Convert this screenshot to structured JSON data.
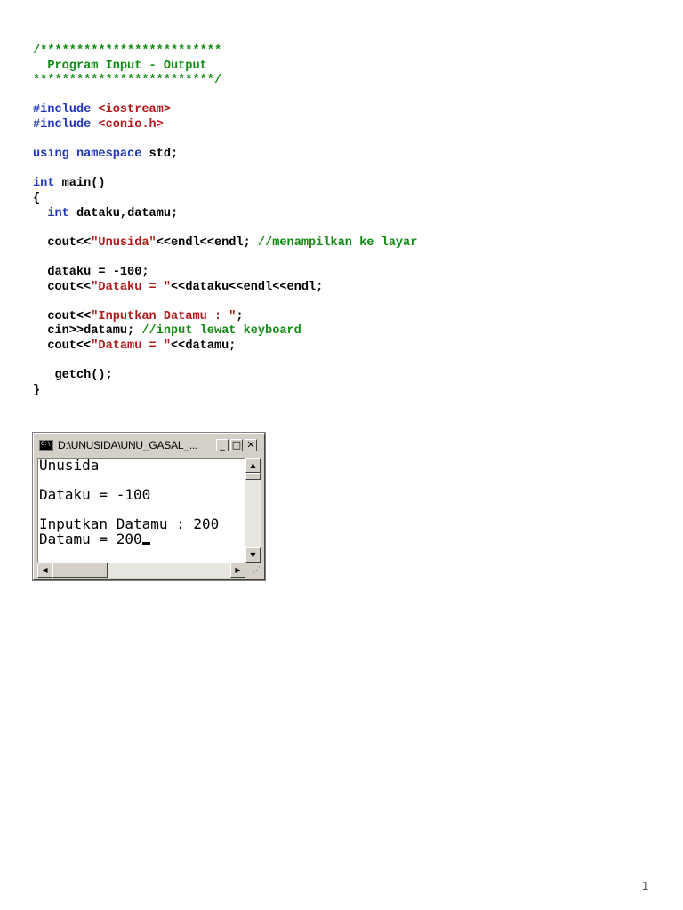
{
  "code_lines": [
    [
      {
        "t": "/*************************",
        "c": "c"
      }
    ],
    [
      {
        "t": "  Program Input - Output",
        "c": "c"
      }
    ],
    [
      {
        "t": "*************************/",
        "c": "c"
      }
    ],
    [],
    [
      {
        "t": "#include ",
        "c": "k"
      },
      {
        "t": "<iostream>",
        "c": "s"
      }
    ],
    [
      {
        "t": "#include ",
        "c": "k"
      },
      {
        "t": "<conio.h>",
        "c": "s"
      }
    ],
    [],
    [
      {
        "t": "using namespace",
        "c": "k"
      },
      {
        "t": " std;",
        "c": "n"
      }
    ],
    [],
    [
      {
        "t": "int",
        "c": "k"
      },
      {
        "t": " main()",
        "c": "n"
      }
    ],
    [
      {
        "t": "{",
        "c": "n"
      }
    ],
    [
      {
        "t": "  ",
        "c": "n"
      },
      {
        "t": "int",
        "c": "k"
      },
      {
        "t": " dataku,datamu;",
        "c": "n"
      }
    ],
    [],
    [
      {
        "t": "  cout<<",
        "c": "n"
      },
      {
        "t": "\"Unusida\"",
        "c": "s"
      },
      {
        "t": "<<endl<<endl; ",
        "c": "n"
      },
      {
        "t": "//menampilkan ke layar",
        "c": "c"
      }
    ],
    [],
    [
      {
        "t": "  dataku = -100;",
        "c": "n"
      }
    ],
    [
      {
        "t": "  cout<<",
        "c": "n"
      },
      {
        "t": "\"Dataku = \"",
        "c": "s"
      },
      {
        "t": "<<dataku<<endl<<endl;",
        "c": "n"
      }
    ],
    [],
    [
      {
        "t": "  cout<<",
        "c": "n"
      },
      {
        "t": "\"Inputkan Datamu : \"",
        "c": "s"
      },
      {
        "t": ";",
        "c": "n"
      }
    ],
    [
      {
        "t": "  cin>>datamu; ",
        "c": "n"
      },
      {
        "t": "//input lewat keyboard",
        "c": "c"
      }
    ],
    [
      {
        "t": "  cout<<",
        "c": "n"
      },
      {
        "t": "\"Datamu = \"",
        "c": "s"
      },
      {
        "t": "<<datamu;",
        "c": "n"
      }
    ],
    [],
    [
      {
        "t": "  _getch();",
        "c": "n"
      }
    ],
    [
      {
        "t": "}",
        "c": "n"
      }
    ]
  ],
  "console": {
    "title": "D:\\UNUSIDA\\UNU_GASAL_...",
    "icon_label": "C:\\",
    "minimize_glyph": "_",
    "maximize_glyph": "□",
    "close_glyph": "✕",
    "lines": [
      "Unusida",
      "",
      "Dataku = -100",
      "",
      "Inputkan Datamu : 200",
      "Datamu = 200"
    ],
    "scroll_up": "▲",
    "scroll_down": "▼",
    "scroll_left": "◀",
    "scroll_right": "▶"
  },
  "page_number": "1",
  "colors": {
    "comment": "#138a13",
    "keyword": "#1f37b8",
    "string": "#b01a1a",
    "text": "#000000"
  }
}
